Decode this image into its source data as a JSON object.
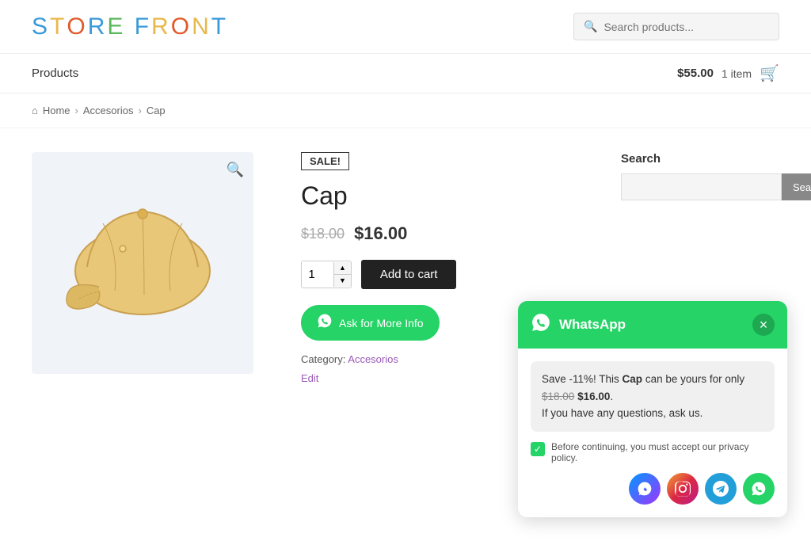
{
  "header": {
    "logo": "STORE FRONT",
    "search_placeholder": "Search products..."
  },
  "navbar": {
    "products_label": "Products",
    "cart_price": "$55.00",
    "cart_count": "1 item"
  },
  "breadcrumb": {
    "home": "Home",
    "category": "Accesorios",
    "product": "Cap"
  },
  "product": {
    "sale_badge": "SALE!",
    "title": "Cap",
    "old_price": "$18.00",
    "new_price": "$16.00",
    "quantity": "1",
    "add_to_cart": "Add to cart",
    "ask_btn": "Ask for More Info",
    "category_label": "Category:",
    "category": "Accesorios",
    "edit": "Edit"
  },
  "sidebar": {
    "search_title": "Search",
    "search_btn": "Search",
    "search_placeholder": ""
  },
  "whatsapp_popup": {
    "title": "WhatsApp",
    "close": "×",
    "message_line1": "Save -11%! This ",
    "message_bold": "Cap",
    "message_line2": " can be yours for only",
    "message_old_price": "$18.00",
    "message_new_price": "$16.00",
    "message_line3": "If you have any questions, ask us.",
    "privacy_text": "Before continuing, you must accept our privacy policy."
  },
  "icons": {
    "search": "🔍",
    "cart": "🛒",
    "home": "⌂",
    "zoom": "🔍",
    "whatsapp": "●",
    "messenger": "m",
    "instagram": "📷",
    "telegram": "✈",
    "close": "✕",
    "check": "✓",
    "up": "▲",
    "down": "▼"
  }
}
